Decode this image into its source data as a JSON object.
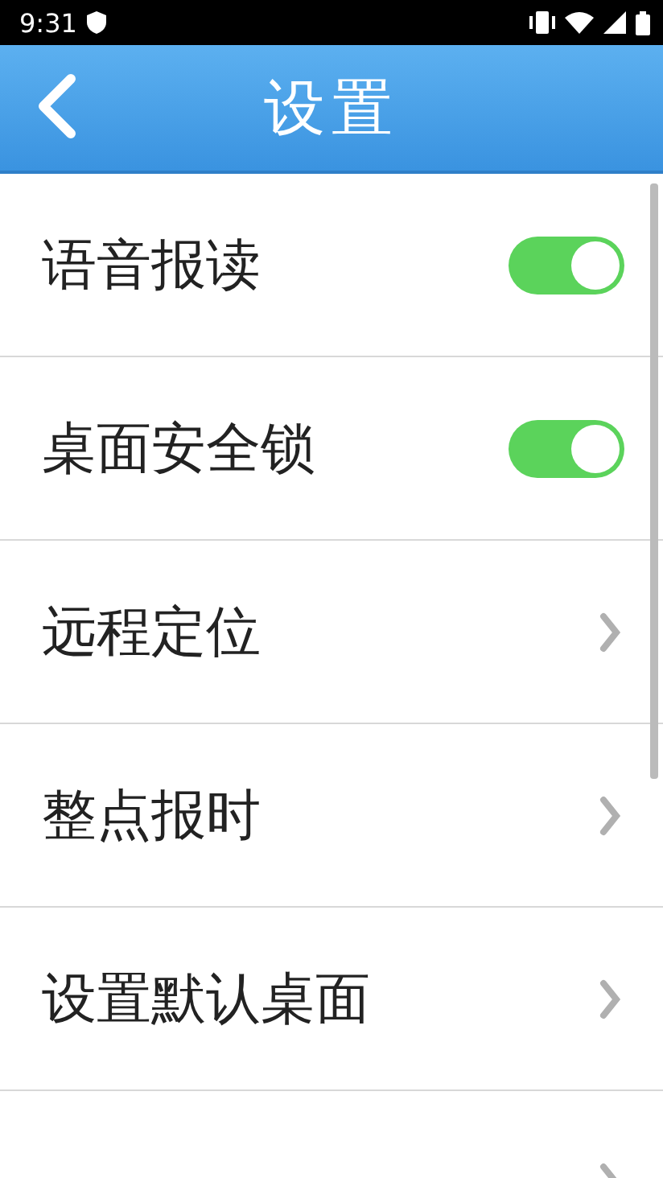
{
  "status_bar": {
    "time": "9:31"
  },
  "header": {
    "title": "设置"
  },
  "items": [
    {
      "kind": "toggle",
      "label": "语音报读",
      "on": true
    },
    {
      "kind": "toggle",
      "label": "桌面安全锁",
      "on": true
    },
    {
      "kind": "link",
      "label": "远程定位"
    },
    {
      "kind": "link",
      "label": "整点报时"
    },
    {
      "kind": "link",
      "label": "设置默认桌面"
    },
    {
      "kind": "link"
    }
  ]
}
